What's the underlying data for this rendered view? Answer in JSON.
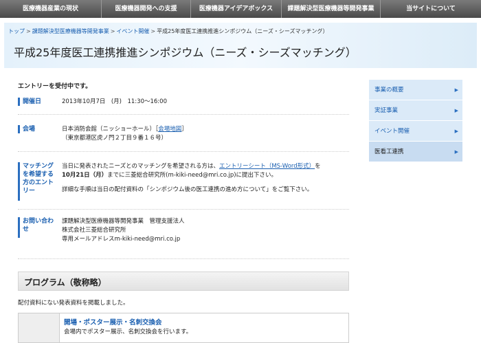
{
  "nav": {
    "items": [
      "医療機器産業の現状",
      "医療機器開発への支援",
      "医療機器アイデアボックス",
      "課題解決型医療機器等開発事業",
      "当サイトについて"
    ]
  },
  "breadcrumb": {
    "items": [
      "トップ",
      "課題解決型医療機器等開発事業",
      "イベント開催",
      "平成25年度医工連携推進シンポジウム（ニーズ・シーズマッチング）"
    ],
    "separator": ">"
  },
  "page_title": "平成25年度医工連携推進シンポジウム（ニーズ・シーズマッチング）",
  "main": {
    "accepting": "エントリーを受付中です。",
    "date": {
      "label": "開催日",
      "value": "2013年10月7日　(月)　11:30～16:00"
    },
    "venue": {
      "label": "会場",
      "line1": "日本消防会館（ニッショーホール）［",
      "map_link": "会場地図",
      "line1_end": "］",
      "line2": "（東京都港区虎ノ門２丁目９番１６号）"
    },
    "matching": {
      "label": "マッチングを希望する方のエントリー",
      "text_pre": "当日に発表されたニーズとのマッチングを希望される方は、",
      "entry_link": "エントリーシート（MS-Word形式）",
      "text_mid": "を",
      "deadline": "10月21日（月）",
      "text_post": "までに三菱総合研究所(m-kiki-need@mri.co.jp)に提出下さい。",
      "note": "詳細な手順は当日の配付資料の「シンポジウム後の医工連携の進め方について」をご覧下さい。"
    },
    "contact": {
      "label": "お問い合わせ",
      "line1": "課題解決型医療機器等開発事業　管理支援法人",
      "line2": "株式会社三菱総合研究所",
      "line3": "専用メールアドレスm-kiki-need@mri.co.jp"
    },
    "program": {
      "title": "プログラム（敬称略）",
      "note": "配付資料にない発表資料を掲載しました。",
      "item_title": "開場・ポスター展示・名刺交換会",
      "item_desc": "会場内でポスター展示、名刺交換会を行います。"
    }
  },
  "sidebar": {
    "items": [
      {
        "label": "事業の概要"
      },
      {
        "label": "実証事業"
      },
      {
        "label": "イベント開催"
      },
      {
        "label": "医看工連携"
      }
    ],
    "arrow": "▶"
  },
  "colors": {
    "accent": "#1a5fb0",
    "nav_bg": "#5a5a5a",
    "sidebar_bg": "#dbeaf8"
  }
}
